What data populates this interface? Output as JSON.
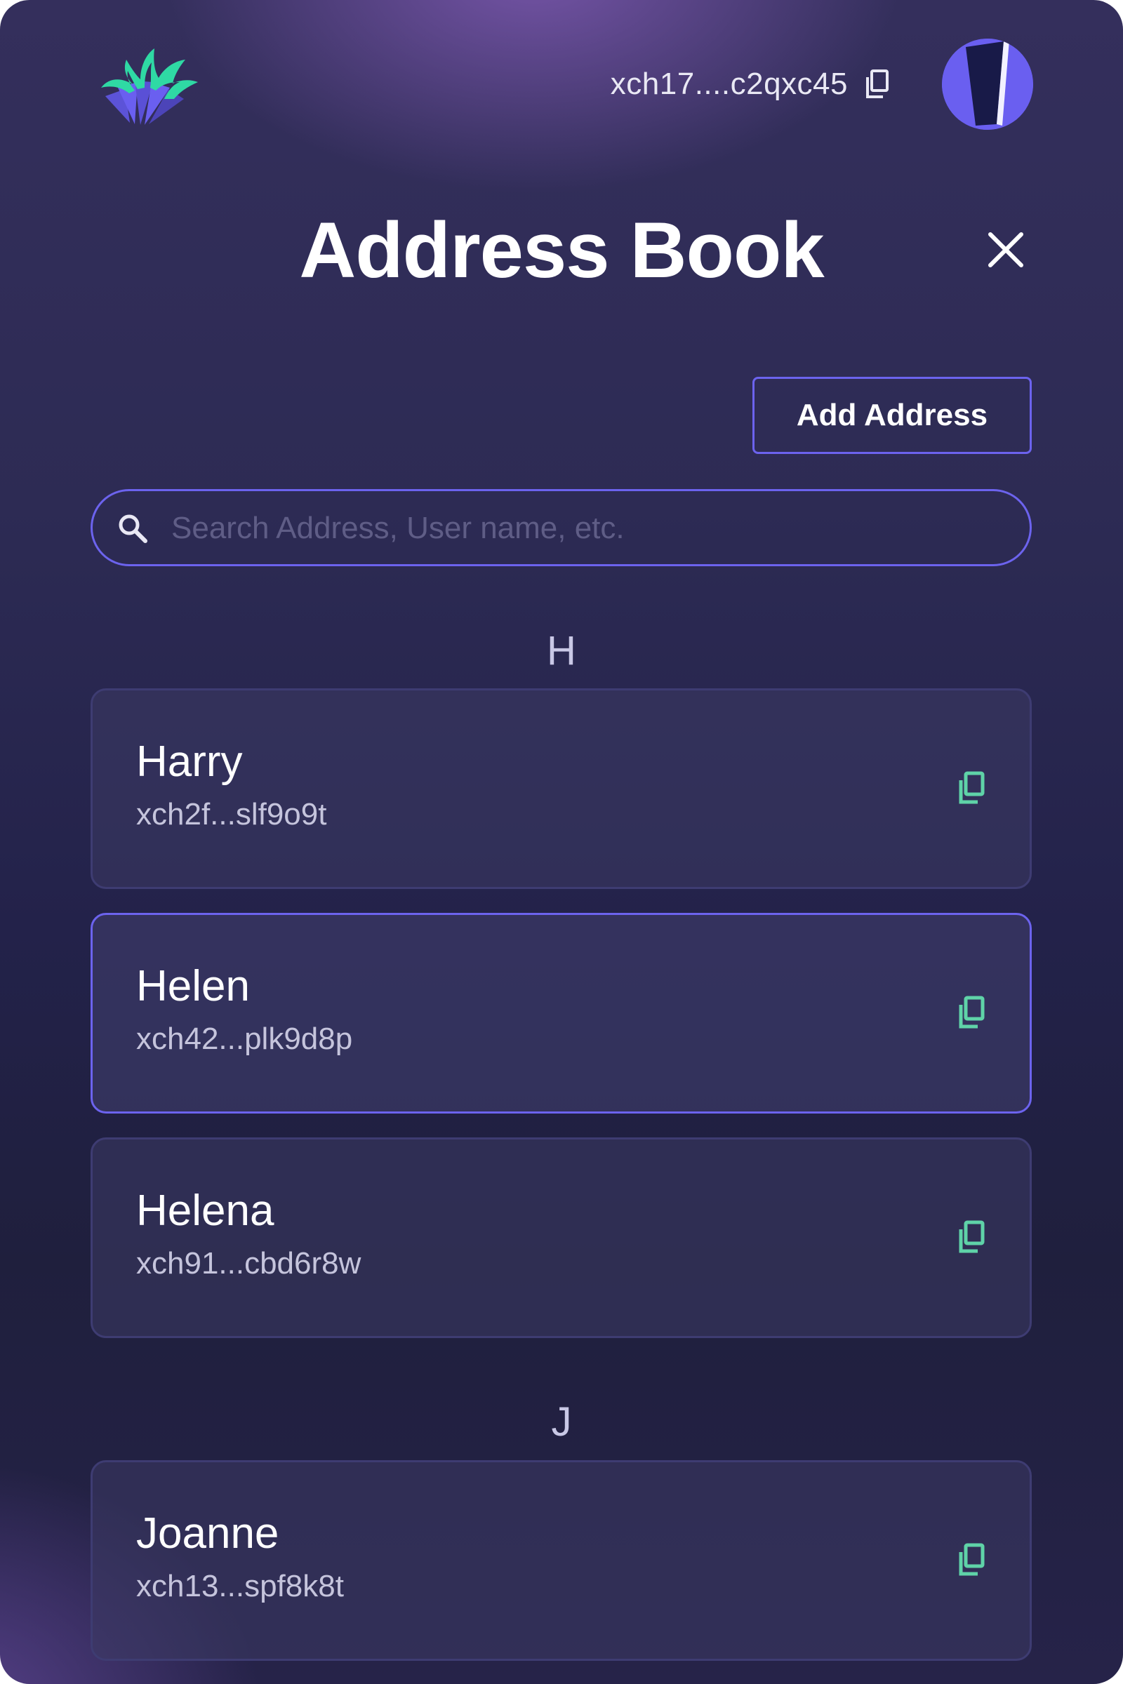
{
  "header": {
    "wallet_address": "xch17....c2qxc45",
    "logo_icon": "fan-logo-icon",
    "copy_icon": "copy-icon",
    "avatar_icon": "avatar-icon"
  },
  "page": {
    "title": "Address Book",
    "close_icon": "close-icon"
  },
  "actions": {
    "add_address_label": "Add Address"
  },
  "search": {
    "placeholder": "Search Address, User name, etc.",
    "value": "",
    "icon": "search-icon"
  },
  "sections": [
    {
      "letter": "H",
      "contacts": [
        {
          "name": "Harry",
          "address": "xch2f...slf9o9t",
          "selected": false
        },
        {
          "name": "Helen",
          "address": "xch42...plk9d8p",
          "selected": true
        },
        {
          "name": "Helena",
          "address": "xch91...cbd6r8w",
          "selected": false
        }
      ]
    },
    {
      "letter": "J",
      "contacts": [
        {
          "name": "Joanne",
          "address": "xch13...spf8k8t",
          "selected": false
        }
      ]
    }
  ],
  "colors": {
    "accent": "#6c63ee",
    "copy_icon": "#5fd3a8",
    "logo_teal": "#2fd9a4",
    "logo_purple": "#6a5ff0",
    "background_top": "#342f5c",
    "background_bottom": "#1f1f3d"
  }
}
